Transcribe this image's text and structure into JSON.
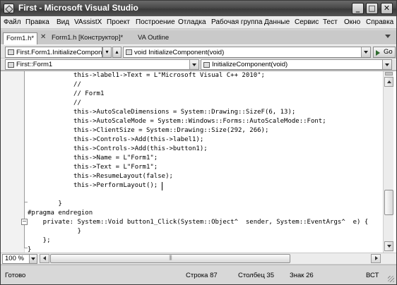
{
  "window": {
    "title": "First - Microsoft Visual Studio"
  },
  "titlebar_buttons": {
    "minimize": "_",
    "maximize": "□",
    "close": "✕"
  },
  "menu": [
    "Файл",
    "Правка",
    "Вид",
    "VAssistX",
    "Проект",
    "Построение",
    "Отладка",
    "Рабочая группа",
    "Данные",
    "Сервис",
    "Тест",
    "Окно",
    "Справка"
  ],
  "tabs": [
    "Form1.h*",
    "Form1.h [Конструктор]*",
    "VA Outline"
  ],
  "tab_close": "✕",
  "nav1": {
    "left_combo": "First.Form1.InitializeComponer",
    "right_combo": "void InitializeComponent(void)",
    "go_label": "Go"
  },
  "nav2": {
    "left_combo": "First::Form1",
    "right_combo": "InitializeComponent(void)"
  },
  "code": [
    "            this->label1->Text = L\"Microsoft Visual C++ 2010\";",
    "            //",
    "            // Form1",
    "            //",
    "            this->AutoScaleDimensions = System::Drawing::SizeF(6, 13);",
    "            this->AutoScaleMode = System::Windows::Forms::AutoScaleMode::Font;",
    "            this->ClientSize = System::Drawing::Size(292, 266);",
    "            this->Controls->Add(this->label1);",
    "            this->Controls->Add(this->button1);",
    "            this->Name = L\"Form1\";",
    "            this->Text = L\"Form1\";",
    "            this->ResumeLayout(false);",
    "            this->PerformLayout();",
    "",
    "        }",
    "#pragma endregion",
    "    private: System::Void button1_Click(System::Object^  sender, System::EventArgs^  e) {",
    "             }",
    "    };",
    "}"
  ],
  "zoom": "100 %",
  "status": {
    "ready": "Готово",
    "line": "Строка 87",
    "column": "Столбец 35",
    "char": "Знак 26",
    "insert_mode": "ВСТ"
  }
}
